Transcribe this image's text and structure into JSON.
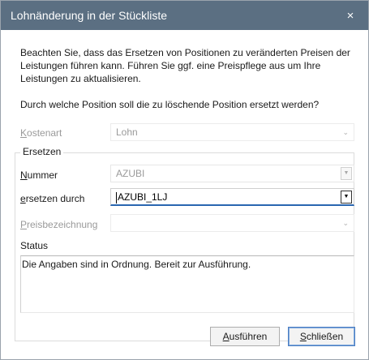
{
  "window": {
    "title": "Lohnänderung in der Stückliste",
    "close_glyph": "×"
  },
  "intro_text": "Beachten Sie, dass das Ersetzen von Positionen zu veränderten Preisen der Leistungen führen kann. Führen Sie ggf. eine Preispflege aus um Ihre Leistungen zu aktualisieren.",
  "question_text": "Durch welche Position soll die zu löschende Position ersetzt werden?",
  "kostenart": {
    "label_key": "K",
    "label_rest": "ostenart",
    "value": "Lohn"
  },
  "group": {
    "legend": "Ersetzen",
    "nummer": {
      "label_key": "N",
      "label_rest": "ummer",
      "value": "AZUBI"
    },
    "ersetzen": {
      "label_key": "e",
      "label_rest": "rsetzen durch",
      "value": "AZUBI_1LJ"
    },
    "preis": {
      "label_key": "P",
      "label_rest": "reisbezeichnung",
      "value": ""
    }
  },
  "status": {
    "label": "Status",
    "text": "Die Angaben sind in Ordnung. Bereit zur Ausführung."
  },
  "buttons": {
    "execute": {
      "key": "A",
      "rest": "usführen"
    },
    "close": {
      "key": "S",
      "rest": "chließen"
    }
  },
  "icons": {
    "dropdown": "chevron-down-icon",
    "close": "close-icon"
  },
  "colors": {
    "titlebar": "#5b6f82",
    "accent_underline": "#2a66b0"
  }
}
